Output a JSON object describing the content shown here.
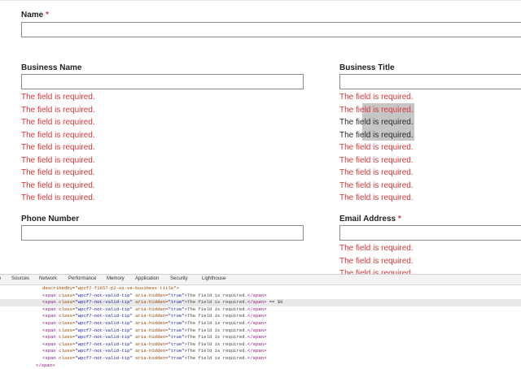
{
  "form": {
    "name_label": "Name",
    "required_mark": "*",
    "business_name_label": "Business Name",
    "business_title_label": "Business Title",
    "phone_label": "Phone Number",
    "email_label": "Email Address",
    "error_text": "The field is required."
  },
  "devtools": {
    "tabs": [
      "e",
      "Sources",
      "Network",
      "Performance",
      "Memory",
      "Application",
      "Security",
      "Lighthouse"
    ],
    "top_partial_line": "describedby=\"wpcf7-f2657-p2-o1-ve-business-title\">",
    "span_open": "<span",
    "class_attr": "class=",
    "class_value": "\"wpcf7-not-valid-tip\"",
    "aria_attr": "aria-hidden=",
    "aria_value": "\"true\"",
    "content": ">The field is required.",
    "span_close": "</span>",
    "selected_suffix": " == $0",
    "closing_line": "</span>"
  }
}
